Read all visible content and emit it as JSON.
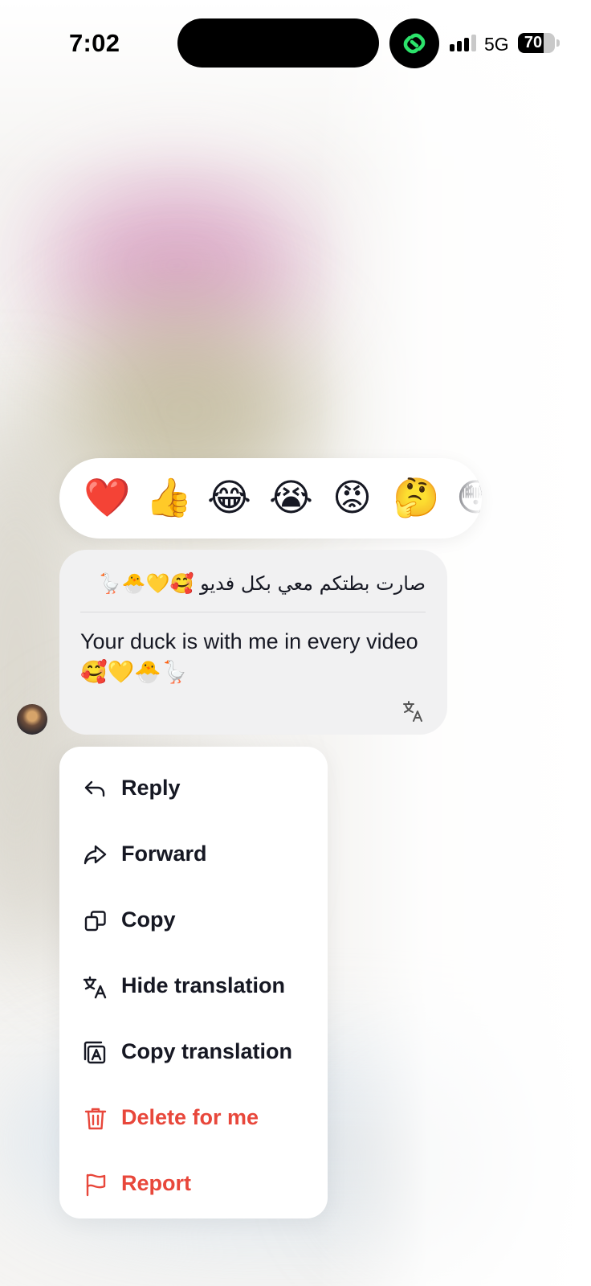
{
  "status_bar": {
    "time": "7:02",
    "network": "5G",
    "battery": "70",
    "app_icon": "link-app-icon"
  },
  "reactions": [
    {
      "emoji": "❤️",
      "name": "heart"
    },
    {
      "emoji": "👍",
      "name": "thumbs-up"
    },
    {
      "emoji": "😂",
      "name": "laughing"
    },
    {
      "emoji": "😭",
      "name": "crying"
    },
    {
      "emoji": "😡",
      "name": "angry"
    },
    {
      "emoji": "🤔",
      "name": "thinking"
    },
    {
      "emoji": "😳",
      "name": "flushed"
    }
  ],
  "message": {
    "original": "صارت بطتكم معي بكل فديو 🥰💛🐣🪿",
    "translation": "Your duck is with me in every video 🥰💛🐣🪿",
    "translate_icon": "translate-icon"
  },
  "menu": {
    "items": [
      {
        "label": "Reply",
        "icon": "reply-icon",
        "danger": false
      },
      {
        "label": "Forward",
        "icon": "forward-icon",
        "danger": false
      },
      {
        "label": "Copy",
        "icon": "copy-icon",
        "danger": false
      },
      {
        "label": "Hide translation",
        "icon": "translate-icon",
        "danger": false
      },
      {
        "label": "Copy translation",
        "icon": "copy-translation-icon",
        "danger": false
      },
      {
        "label": "Delete for me",
        "icon": "trash-icon",
        "danger": true
      },
      {
        "label": "Report",
        "icon": "flag-icon",
        "danger": true
      }
    ]
  },
  "colors": {
    "danger": "#e8473b",
    "text": "#161823",
    "bubble": "#f1f1f2",
    "accent": "#2ce36b"
  }
}
